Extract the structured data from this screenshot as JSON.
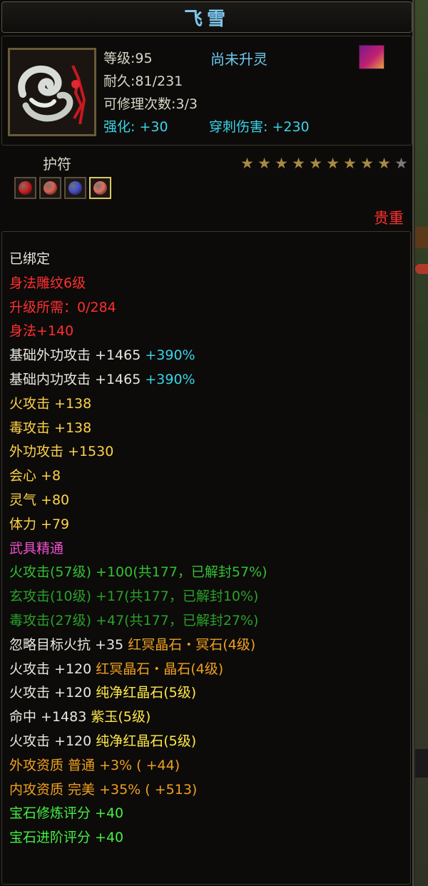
{
  "title": "飞雪",
  "info": {
    "level": "等级:95",
    "spirit_status": "尚未升灵",
    "durability": "耐久:81/231",
    "repair": "可修理次数:3/3",
    "enhance": "强化: +30",
    "pierce": "穿刺伤害: +230"
  },
  "amulet": {
    "label": "护符",
    "stars_filled": 9,
    "stars_total": 10,
    "gems": [
      {
        "icon": "red-gem-icon",
        "color": "#d02020"
      },
      {
        "icon": "salmon-gem-icon",
        "color": "#e06050"
      },
      {
        "icon": "blue-gem-icon",
        "color": "#4050d0"
      },
      {
        "icon": "salmon-gem-icon",
        "color": "#e07060",
        "selected": true
      }
    ],
    "weight_label": "贵重"
  },
  "stats": [
    {
      "color": "white",
      "parts": [
        {
          "t": "已绑定"
        }
      ]
    },
    {
      "color": "red",
      "parts": [
        {
          "t": "身法雕纹6级"
        }
      ]
    },
    {
      "color": "red",
      "parts": [
        {
          "t": "升级所需：0/284"
        }
      ]
    },
    {
      "color": "red",
      "parts": [
        {
          "t": "身法+140"
        }
      ]
    },
    {
      "color": "white",
      "parts": [
        {
          "t": "基础外功攻击 +1465 "
        },
        {
          "t": "+390%",
          "color": "cyan"
        }
      ]
    },
    {
      "color": "white",
      "parts": [
        {
          "t": "基础内功攻击 +1465 "
        },
        {
          "t": "+390%",
          "color": "cyan"
        }
      ]
    },
    {
      "color": "gold",
      "parts": [
        {
          "t": "火攻击 +138"
        }
      ]
    },
    {
      "color": "gold",
      "parts": [
        {
          "t": "毒攻击 +138"
        }
      ]
    },
    {
      "color": "gold",
      "parts": [
        {
          "t": "外功攻击 +1530"
        }
      ]
    },
    {
      "color": "gold",
      "parts": [
        {
          "t": "会心 +8"
        }
      ]
    },
    {
      "color": "gold",
      "parts": [
        {
          "t": "灵气 +80"
        }
      ]
    },
    {
      "color": "gold",
      "parts": [
        {
          "t": "体力 +79"
        }
      ]
    },
    {
      "color": "pink",
      "parts": [
        {
          "t": "武具精通"
        }
      ]
    },
    {
      "color": "green",
      "parts": [
        {
          "t": "火攻击(57级) +100(共177，已解封57%)"
        }
      ]
    },
    {
      "color": "dkgreen",
      "parts": [
        {
          "t": "玄攻击(10级) +17(共177，已解封10%)"
        }
      ]
    },
    {
      "color": "dkgreen",
      "parts": [
        {
          "t": "毒攻击(27级) +47(共177，已解封27%)"
        }
      ]
    },
    {
      "color": "white",
      "parts": [
        {
          "t": "忽略目标火抗 +35 "
        },
        {
          "t": "红冥晶石・冥石(4级)",
          "color": "orange"
        }
      ]
    },
    {
      "color": "white",
      "parts": [
        {
          "t": "火攻击 +120 "
        },
        {
          "t": "红冥晶石・晶石(4级)",
          "color": "orange"
        }
      ]
    },
    {
      "color": "white",
      "parts": [
        {
          "t": "火攻击 +120 "
        },
        {
          "t": "纯净红晶石(5级)",
          "color": "yellow"
        }
      ]
    },
    {
      "color": "white",
      "parts": [
        {
          "t": "命中 +1483 "
        },
        {
          "t": "紫玉(5级)",
          "color": "yellow"
        }
      ]
    },
    {
      "color": "white",
      "parts": [
        {
          "t": "火攻击 +120 "
        },
        {
          "t": "纯净红晶石(5级)",
          "color": "yellow"
        }
      ]
    },
    {
      "color": "orange",
      "parts": [
        {
          "t": "外攻资质  普通 +3% ( +44)"
        }
      ]
    },
    {
      "color": "orange",
      "parts": [
        {
          "t": "内攻资质  完美 +35% ( +513)"
        }
      ]
    },
    {
      "color": "brightgreen",
      "parts": [
        {
          "t": "宝石修炼评分 +40"
        }
      ]
    },
    {
      "color": "brightgreen",
      "parts": [
        {
          "t": "宝石进阶评分 +40"
        }
      ]
    }
  ]
}
